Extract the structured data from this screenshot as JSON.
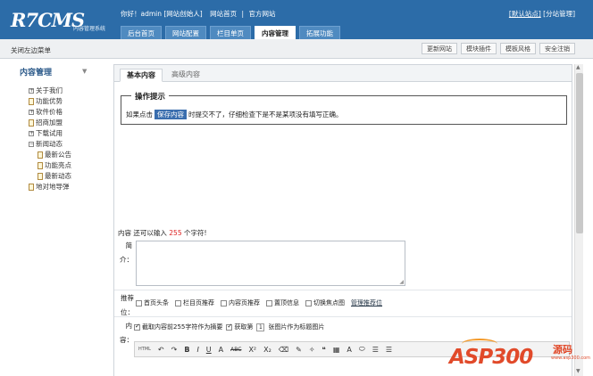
{
  "header": {
    "logo": "R7CMS",
    "logo_sub": "内容管理系统",
    "welcome": "你好！admin [网站创始人]",
    "home_link": "网站首页",
    "official_link": "官方网站",
    "default_site": "[默认站点]",
    "switch_site": "[分站管理]",
    "nav": [
      "后台首页",
      "网站配置",
      "栏目单页",
      "内容管理",
      "拓展功能"
    ],
    "active_nav": "内容管理"
  },
  "toolbar": {
    "close_menu": "关闭左边菜单",
    "buttons": [
      "更新网站",
      "模块插件",
      "模板风格",
      "安全注销"
    ]
  },
  "sidebar": {
    "title": "内容管理",
    "items": [
      {
        "label": "关于我们",
        "icon": "folder-plus-icon"
      },
      {
        "label": "功能优势",
        "icon": "page-icon"
      },
      {
        "label": "软件价格",
        "icon": "folder-plus-icon"
      },
      {
        "label": "招商加盟",
        "icon": "page-icon"
      },
      {
        "label": "下载试用",
        "icon": "folder-plus-icon"
      },
      {
        "label": "新闻动态",
        "icon": "folder-minus-icon"
      },
      {
        "label": "最新公告",
        "icon": "page-icon",
        "child": true
      },
      {
        "label": "功能亮点",
        "icon": "page-icon",
        "child": true
      },
      {
        "label": "最新动态",
        "icon": "page-icon",
        "child": true
      },
      {
        "label": "地对地导弹",
        "icon": "page-icon"
      }
    ]
  },
  "content": {
    "tabs": [
      "基本内容",
      "高级内容"
    ],
    "tip_title": "操作提示",
    "tip_pre": "如果点击",
    "tip_highlight": "保存内容",
    "tip_post": "时提交不了，仔细检查下是不是某项没有填写正确。",
    "desc_pre": "内容 还可以输入",
    "desc_count": "255",
    "desc_post": "个字符!",
    "summary_label_1": "简",
    "summary_label_2": "介：",
    "rec_label_1": "推荐",
    "rec_label_2": "位：",
    "recommend": [
      "首页头条",
      "栏目页推荐",
      "内容页推荐",
      "置顶信息",
      "切换焦点图"
    ],
    "manage_link": "管理推荐位",
    "content_label_1": "内",
    "content_label_2": "容：",
    "opt_extract": "截取内容前255字符作为摘要",
    "opt_get": "获取第",
    "opt_num": "1",
    "opt_get_post": "张图片作为标题图片",
    "editor_tools": [
      "HTML",
      "↶",
      "↷",
      "B",
      "I",
      "U",
      "A",
      "ABC",
      "X²",
      "X₂",
      "⌫",
      "✎",
      "✧",
      "❝",
      "▦",
      "A",
      "⬭",
      "☰",
      "☰"
    ]
  },
  "watermark": {
    "brand": "ASP300",
    "yuan": "源码",
    "url": "www.asp300.com"
  },
  "colors": {
    "header_bg": "#2c6ca8",
    "highlight": "#3a6eae",
    "count_red": "#dd2222",
    "watermark": "#e14a2a"
  }
}
